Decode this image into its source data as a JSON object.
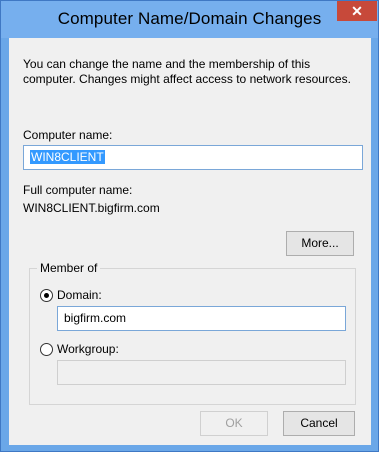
{
  "window": {
    "title": "Computer Name/Domain Changes",
    "close_glyph": "✕"
  },
  "intro_text": "You can change the name and the membership of this computer. Changes might affect access to network resources.",
  "computer_name": {
    "label": "Computer name:",
    "value": "WIN8CLIENT"
  },
  "full_name": {
    "label": "Full computer name:",
    "value": "WIN8CLIENT.bigfirm.com"
  },
  "buttons": {
    "more": "More...",
    "ok": "OK",
    "cancel": "Cancel"
  },
  "member_of": {
    "label": "Member of",
    "domain": {
      "label": "Domain:",
      "selected": true,
      "value": "bigfirm.com"
    },
    "workgroup": {
      "label": "Workgroup:",
      "selected": false,
      "value": ""
    }
  },
  "colors": {
    "title_bar": "#76afee",
    "close_button": "#c7493a",
    "selection": "#3399ff",
    "dialog_background": "#f0f0f0"
  }
}
